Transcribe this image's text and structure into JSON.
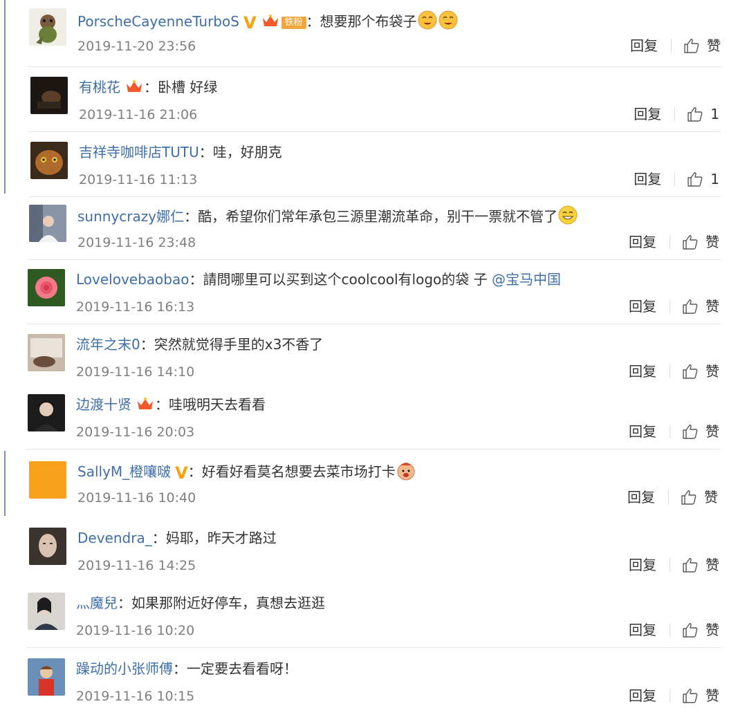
{
  "comments": [
    {
      "user": "PorscheCayenneTurboS",
      "text": "想要那个布袋子",
      "date": "2019-11-20 23:56",
      "reply": "回复",
      "like": "赞",
      "fan_badge": "铁粉"
    },
    {
      "user": "有桃花",
      "text": "卧槽 好绿",
      "date": "2019-11-16 21:06",
      "reply": "回复",
      "like": "1"
    },
    {
      "user": "吉祥寺咖啡店TUTU",
      "text": "哇，好朋克",
      "date": "2019-11-16 11:13",
      "reply": "回复",
      "like": "1"
    },
    {
      "user": "sunnycrazy娜仁",
      "text": "酷，希望你们常年承包三源里潮流革命，别干一票就不管了",
      "date": "2019-11-16 23:48",
      "reply": "回复",
      "like": "赞"
    },
    {
      "user": "Lovelovebaobao",
      "text": "請問哪里可以买到这个coolcool有logo的袋 子",
      "mention": "@宝马中国",
      "date": "2019-11-16 16:13",
      "reply": "回复",
      "like": "赞"
    },
    {
      "user": "流年之末0",
      "text": "突然就觉得手里的x3不香了",
      "date": "2019-11-16 14:10",
      "reply": "回复",
      "like": "赞"
    },
    {
      "user": "边渡十贤",
      "text": "哇哦明天去看看",
      "date": "2019-11-16 20:03",
      "reply": "回复",
      "like": "赞"
    },
    {
      "user": "SallyM_橙嚷啵",
      "text": "好看好看莫名想要去菜市场打卡",
      "date": "2019-11-16 10:40",
      "reply": "回复",
      "like": "赞"
    },
    {
      "user": "Devendra_",
      "text": "妈耶，昨天才路过",
      "date": "2019-11-16 14:25",
      "reply": "回复",
      "like": "赞"
    },
    {
      "user": "灬魔兒",
      "text": "如果那附近好停车，真想去逛逛",
      "date": "2019-11-16 10:20",
      "reply": "回复",
      "like": "赞"
    },
    {
      "user": "躁动的小张师傅",
      "text": "一定要去看看呀！",
      "date": "2019-11-16 10:15",
      "reply": "回复",
      "like": "赞"
    }
  ],
  "colors": {
    "username": "#3d6ea9",
    "date": "#7f7f7f",
    "divider": "#e6e6e6",
    "vip": "#f6a10f"
  },
  "icons": [
    "thumbs-up-icon",
    "crown-badge-icon",
    "verified-v-icon",
    "emoji-icon"
  ]
}
